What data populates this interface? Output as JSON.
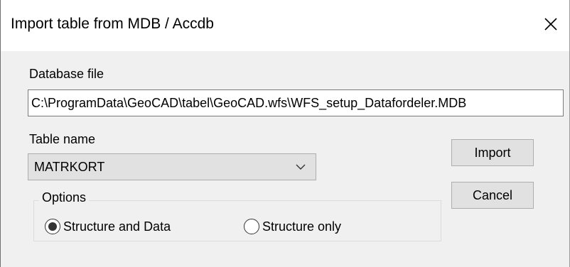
{
  "dialog": {
    "title": "Import table from MDB / Accdb"
  },
  "database_file": {
    "label": "Database file",
    "value": "C:\\ProgramData\\GeoCAD\\tabel\\GeoCAD.wfs\\WFS_setup_Datafordeler.MDB"
  },
  "table_name": {
    "label": "Table name",
    "selected": "MATRKORT"
  },
  "buttons": {
    "import_label": "Import",
    "cancel_label": "Cancel"
  },
  "options": {
    "legend": "Options",
    "radios": [
      {
        "label": "Structure and Data",
        "checked": true
      },
      {
        "label": "Structure only",
        "checked": false
      }
    ]
  },
  "icons": {
    "close": "close-icon",
    "dropdown": "chevron-down-icon"
  },
  "colors": {
    "dialog_bg": "#f0f0f0",
    "titlebar_bg": "#ffffff",
    "button_bg": "#e1e1e1"
  }
}
